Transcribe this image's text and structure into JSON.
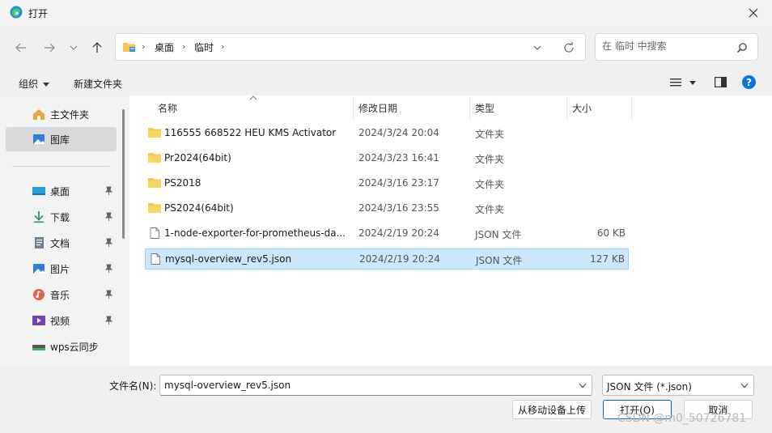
{
  "window": {
    "title": "打开"
  },
  "address": {
    "crumbs": [
      "桌面",
      "临时"
    ],
    "search_placeholder": "在 临时 中搜索"
  },
  "toolbar": {
    "organize": "组织",
    "new_folder": "新建文件夹"
  },
  "sidebar": {
    "top_items": [
      {
        "label": "主文件夹",
        "icon": "home-icon"
      },
      {
        "label": "图库",
        "icon": "gallery-icon"
      }
    ],
    "pinned_items": [
      {
        "label": "桌面",
        "icon": "desktop-icon"
      },
      {
        "label": "下载",
        "icon": "download-icon"
      },
      {
        "label": "文档",
        "icon": "document-icon"
      },
      {
        "label": "图片",
        "icon": "pictures-icon"
      },
      {
        "label": "音乐",
        "icon": "music-icon"
      },
      {
        "label": "视频",
        "icon": "video-icon"
      },
      {
        "label": "wps云同步",
        "icon": "cloud-sync-icon"
      }
    ]
  },
  "columns": {
    "name": "名称",
    "modified": "修改日期",
    "type": "类型",
    "size": "大小"
  },
  "files": [
    {
      "name": "116555 668522 HEU KMS Activator",
      "modified": "2024/3/24 20:04",
      "type": "文件夹",
      "size": "",
      "kind": "folder"
    },
    {
      "name": "Pr2024(64bit)",
      "modified": "2024/3/23 16:41",
      "type": "文件夹",
      "size": "",
      "kind": "folder"
    },
    {
      "name": "PS2018",
      "modified": "2024/3/16 23:17",
      "type": "文件夹",
      "size": "",
      "kind": "folder"
    },
    {
      "name": "PS2024(64bit)",
      "modified": "2024/3/16 23:55",
      "type": "文件夹",
      "size": "",
      "kind": "folder"
    },
    {
      "name": "1-node-exporter-for-prometheus-da...",
      "modified": "2024/2/19 20:24",
      "type": "JSON 文件",
      "size": "60 KB",
      "kind": "file"
    },
    {
      "name": "mysql-overview_rev5.json",
      "modified": "2024/2/19 20:24",
      "type": "JSON 文件",
      "size": "127 KB",
      "kind": "file"
    }
  ],
  "bottom": {
    "filename_label": "文件名(N):",
    "filename_value": "mysql-overview_rev5.json",
    "filetype": "JSON 文件 (*.json)",
    "upload_button": "从移动设备上传",
    "open_button": "打开(O)",
    "cancel_button": "取消"
  },
  "watermark": "CSDN @m0_50726781",
  "colors": {
    "accent": "#0067c0",
    "selection": "#cce8ff",
    "folder": "#f8c74d"
  }
}
